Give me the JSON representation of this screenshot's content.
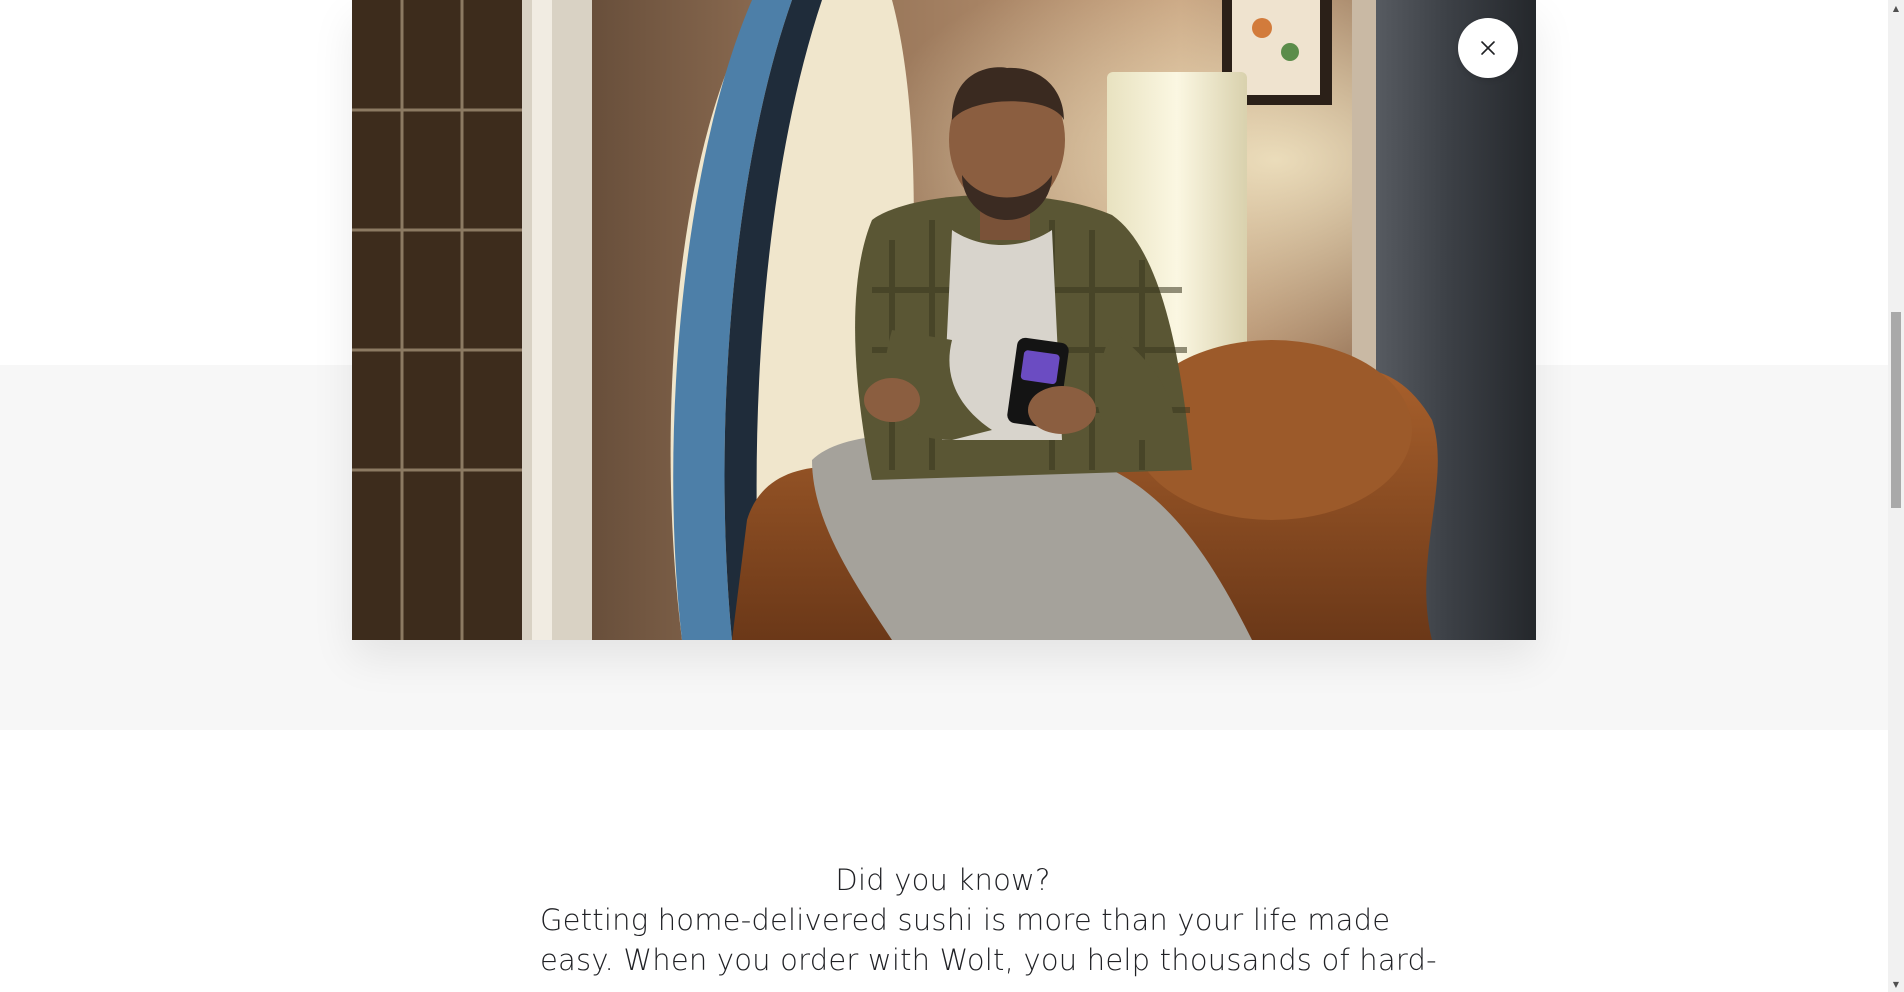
{
  "modal": {
    "close_icon": "close-icon",
    "video_still": "person-on-armchair-using-phone"
  },
  "content": {
    "lines": [
      "Did you know?",
      "Getting home-delivered sushi is more than your life made",
      "easy. When you order with Wolt, you help thousands of hard-"
    ]
  },
  "colors": {
    "band": "#f7f7f7",
    "text": "#202125",
    "scrollbar_thumb": "#a9a9a9"
  },
  "scrollbar": {
    "up_icon": "scroll-up-arrow-icon",
    "down_icon": "scroll-down-arrow-icon"
  }
}
